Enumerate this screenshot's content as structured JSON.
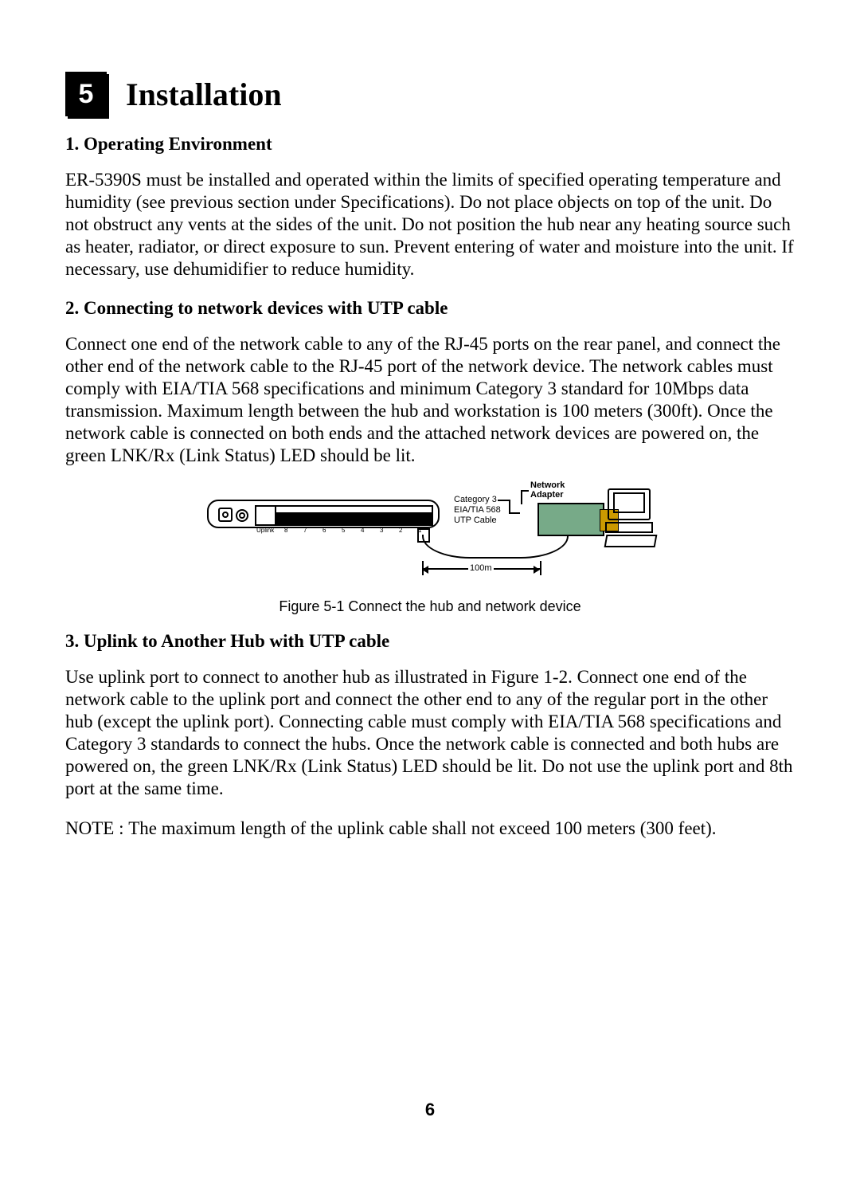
{
  "chapter": {
    "number": "5",
    "title": "Installation"
  },
  "sections": {
    "s1": {
      "title": "1. Operating Environment",
      "body": "ER-5390S must be installed and operated within the limits of specified operating temperature and humidity (see previous section under Specifications). Do not place objects on top of the unit. Do not obstruct any vents at the sides of the unit. Do not position the hub near any heating source such as heater, radiator, or direct exposure to sun. Prevent entering of water and moisture into the unit. If necessary, use dehumidifier to reduce humidity."
    },
    "s2": {
      "title": "2. Connecting to network devices with UTP cable",
      "body": "Connect one end of the network cable to any of the RJ-45 ports on the rear panel, and connect the other end of the network cable to the RJ-45 port of the network device. The network cables must comply with EIA/TIA 568 specifications and minimum Category 3 standard for 10Mbps data transmission.  Maximum length between the hub and workstation is 100 meters (300ft).  Once the network cable is connected on both ends and the attached network devices are powered on, the green LNK/Rx (Link Status) LED should be lit."
    },
    "s3": {
      "title": "3.  Uplink to Another Hub with UTP cable",
      "body": "Use uplink port to connect to another hub as illustrated in Figure 1-2. Connect one end of the network cable to the uplink port and connect the other end to any of the regular port in the other hub (except the uplink port).  Connecting cable must comply with EIA/TIA 568 specifications and Category 3 standards to connect the hubs. Once the network cable is connected and both hubs are powered on, the green LNK/Rx (Link Status) LED should be lit.  Do not use the uplink port and 8th port at the same time."
    }
  },
  "figure": {
    "caption": "Figure 5-1  Connect the hub and network device",
    "labels": {
      "cable_spec_1": "Category 3",
      "cable_spec_2": "EIA/TIA 568",
      "cable_spec_3": "UTP Cable",
      "adapter_1": "Network",
      "adapter_2": "Adapter",
      "distance": "100m",
      "uplink": "Uplink",
      "port8": "8",
      "port7": "7",
      "port6": "6",
      "port5": "5",
      "port4": "4",
      "port3": "3",
      "port2": "2",
      "port1": "1"
    }
  },
  "note": {
    "label": "NOTE : ",
    "body": "The maximum length of the uplink cable shall not exceed 100 meters (300 feet)."
  },
  "page_number": "6"
}
